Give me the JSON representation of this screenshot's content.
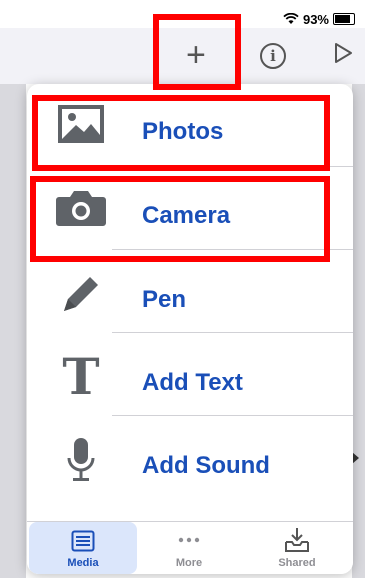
{
  "status_bar": {
    "battery": "93%",
    "icons": [
      "wifi-icon",
      "battery-icon"
    ]
  },
  "toolbar": {
    "buttons": [
      "plus-icon",
      "info-icon",
      "play-icon"
    ]
  },
  "menu": {
    "items": [
      {
        "label": "Photos",
        "icon": "photos-icon"
      },
      {
        "label": "Camera",
        "icon": "camera-icon"
      },
      {
        "label": "Pen",
        "icon": "pen-icon"
      },
      {
        "label": "Add Text",
        "icon": "text-icon"
      },
      {
        "label": "Add Sound",
        "icon": "microphone-icon"
      }
    ]
  },
  "tabbar": {
    "tabs": [
      {
        "label": "Media",
        "icon": "media-icon",
        "selected": true
      },
      {
        "label": "More",
        "icon": "ellipsis-icon",
        "selected": false
      },
      {
        "label": "Shared",
        "icon": "shared-tray-icon",
        "selected": false
      }
    ]
  },
  "colors": {
    "accent": "#1a4fb8",
    "highlight": "#ff0000",
    "icon_gray": "#5f6368",
    "selected_tab_bg": "#dbe6fb"
  }
}
